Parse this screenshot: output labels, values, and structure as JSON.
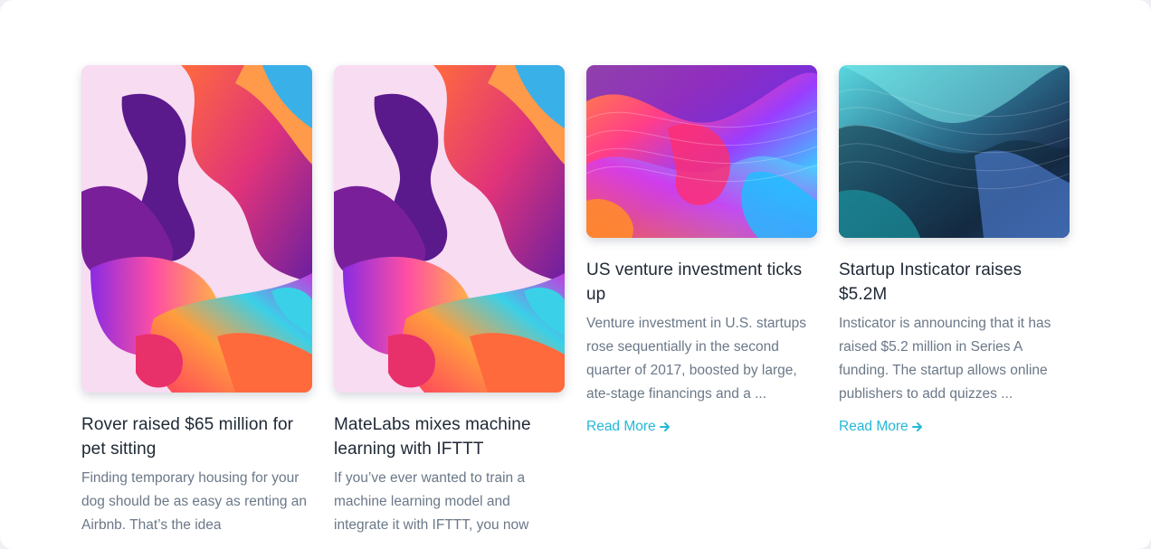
{
  "colors": {
    "title": "#1e2835",
    "excerpt": "#6b7888",
    "link": "#25b8d8"
  },
  "cards": [
    {
      "title": "Rover raised $65 million for pet sitting",
      "excerpt": "Finding temporary housing for your dog should be as easy as renting an Airbnb. That’s the idea",
      "image": "abstract-pink-swirl-art"
    },
    {
      "title": "MateLabs mixes machine learning with IFTTT",
      "excerpt": "If you’ve ever wanted to train a machine learning model and integrate it with IFTTT, you now",
      "image": "abstract-pink-swirl-art"
    },
    {
      "title": "US venture investment ticks up",
      "excerpt": "Venture investment in U.S. startups rose sequentially in the second quarter of 2017, boosted by large, ate-stage financings and a ...",
      "read_more": "Read More",
      "image": "abstract-rainbow-wave-art"
    },
    {
      "title": "Startup Insticator raises $5.2M",
      "excerpt": "Insticator is announcing that it has raised $5.2 million in Series A funding. The startup allows online publishers to add quizzes ...",
      "read_more": "Read More",
      "image": "abstract-teal-wave-art"
    }
  ]
}
